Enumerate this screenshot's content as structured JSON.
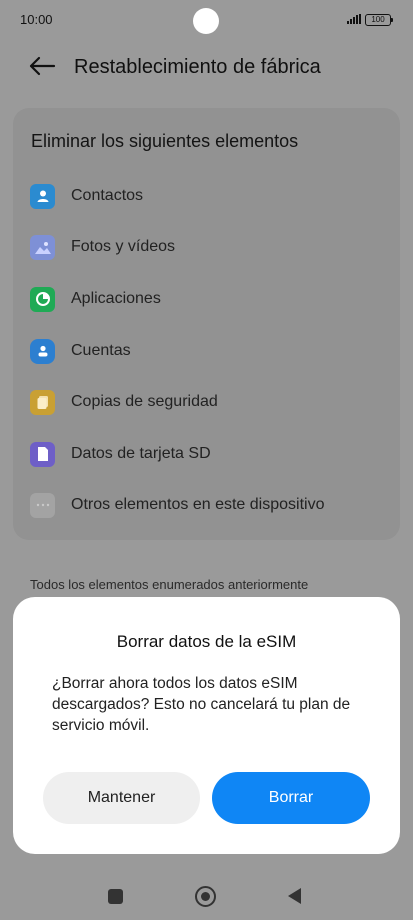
{
  "status": {
    "time": "10:00",
    "battery": "100"
  },
  "header": {
    "title": "Restablecimiento de fábrica"
  },
  "list": {
    "heading": "Eliminar los siguientes elementos",
    "items": [
      {
        "label": "Contactos",
        "icon": "contacts-icon",
        "color": "#2b8bd0"
      },
      {
        "label": "Fotos y vídeos",
        "icon": "gallery-icon",
        "color": "#7e90d6"
      },
      {
        "label": "Aplicaciones",
        "icon": "apps-icon",
        "color": "#1faa55"
      },
      {
        "label": "Cuentas",
        "icon": "accounts-icon",
        "color": "#2c7fd0"
      },
      {
        "label": "Copias de seguridad",
        "icon": "backup-icon",
        "color": "#c9a033"
      },
      {
        "label": "Datos de tarjeta SD",
        "icon": "sd-card-icon",
        "color": "#6e5fc7"
      },
      {
        "label": "Otros elementos en este dispositivo",
        "icon": "more-icon",
        "color": "#a3a3a3"
      }
    ]
  },
  "note": "Todos los elementos enumerados anteriormente",
  "dialog": {
    "title": "Borrar datos de la eSIM",
    "body": "¿Borrar ahora todos los datos eSIM descargados? Esto no cancelará tu plan de servicio móvil.",
    "keep_label": "Mantener",
    "delete_label": "Borrar",
    "accent": "#0f86f5"
  }
}
